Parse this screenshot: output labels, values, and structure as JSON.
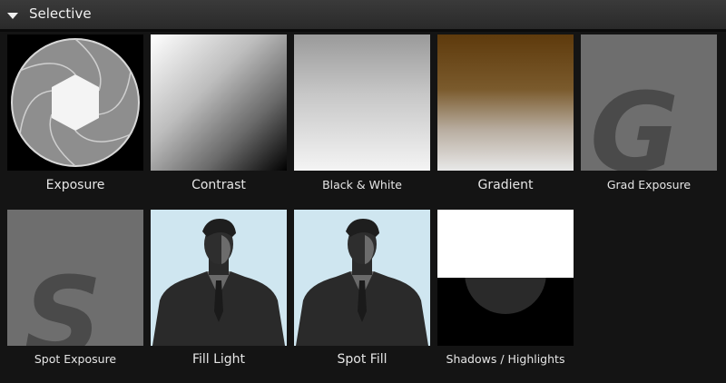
{
  "panel": {
    "title": "Selective",
    "collapse_icon": "triangle-down-icon"
  },
  "tools": [
    {
      "label": "Exposure",
      "icon": "aperture-icon"
    },
    {
      "label": "Contrast",
      "icon": "contrast-gradient-icon"
    },
    {
      "label": "Black & White",
      "icon": "bw-gradient-icon"
    },
    {
      "label": "Gradient",
      "icon": "gradient-icon"
    },
    {
      "label": "Grad Exposure",
      "icon": "letter-g-icon"
    },
    {
      "label": "Spot Exposure",
      "icon": "letter-s-icon"
    },
    {
      "label": "Fill Light",
      "icon": "silhouette-icon"
    },
    {
      "label": "Spot Fill",
      "icon": "silhouette-icon"
    },
    {
      "label": "Shadows / Highlights",
      "icon": "shadows-highlights-icon"
    }
  ],
  "tile_letters": {
    "grad_exposure": "G",
    "spot_exposure": "S"
  },
  "colors": {
    "panel_bg": "#141414",
    "header_bg": "#333333",
    "gradient_top": "#5e3a0c",
    "gradient_bottom": "#e8e8e8",
    "silhouette_bg": "#cfe6f0",
    "letter_tile_bg": "#6e6e6e"
  }
}
